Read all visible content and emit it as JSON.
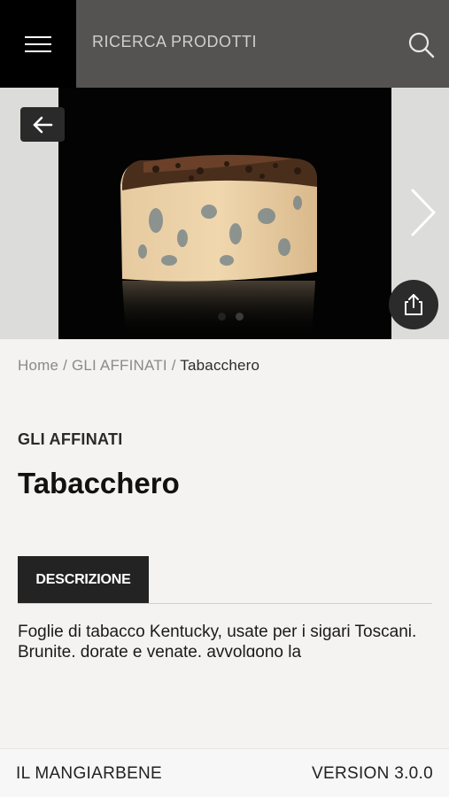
{
  "header": {
    "search_label": "RICERCA PRODOTTI",
    "menu_icon": "hamburger-menu-icon",
    "search_icon": "search-icon"
  },
  "gallery": {
    "image": "blue cheese wedge with tobacco-leaf rind on black background",
    "back_icon": "arrow-left-icon",
    "next_icon": "chevron-right-icon",
    "share_icon": "share-icon",
    "slide_count": 2,
    "active_slide": 1
  },
  "breadcrumb": {
    "home": "Home",
    "sep1": " / ",
    "category": "GLI AFFINATI",
    "sep2": " / ",
    "current": "Tabacchero"
  },
  "product": {
    "category": "GLI AFFINATI",
    "title": "Tabacchero",
    "tab_label": "DESCRIZIONE",
    "description": "Foglie di tabacco Kentucky, usate per i sigari Toscani. Brunite, dorate e venate, avvolgono la"
  },
  "footer": {
    "brand": "IL MANGIARBENE",
    "version": "VERSION 3.0.0"
  },
  "colors": {
    "topbar": "#545351",
    "menu_bg": "#000000",
    "tab_bg": "#232323",
    "page_bg": "#f4f3f1"
  }
}
